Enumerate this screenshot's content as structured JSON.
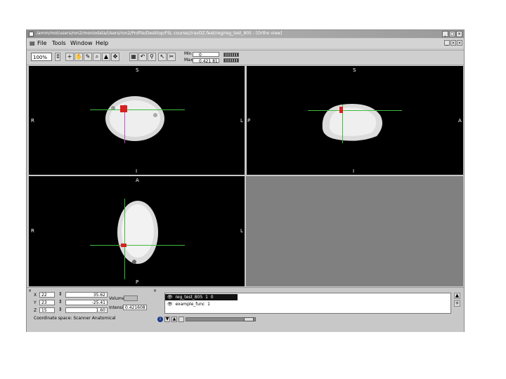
{
  "window": {
    "title": "/amm/mol/users/ron2/mnt/ovdata/Users/ron2/Profile/Desktop/FSL course/fsl/feat/reg/reg_test_805 - [Ortho view]",
    "title_display": "/amm/mol/users/ron2/moniodata/Users/ron2/Profile/Desktop/FSL course///ravDZ.feat/reg/reg_test_805 - [Ortho view]",
    "buttons": [
      "_",
      "□",
      "×"
    ]
  },
  "menu": {
    "items": [
      "File",
      "Tools",
      "Window",
      "Help"
    ],
    "mdi_buttons": [
      "_",
      "×",
      "×"
    ]
  },
  "toolbar": {
    "zoom": "100%",
    "min_label": "Min",
    "min_value": "0",
    "max_label": "Max",
    "max_value": "0.421 81"
  },
  "views": {
    "coronal": {
      "top": "S",
      "bottom": "I",
      "left": "R",
      "right": "L"
    },
    "sagittal": {
      "top": "S",
      "bottom": "I",
      "left": "P",
      "right": "A"
    },
    "axial": {
      "top": "A",
      "bottom": "P",
      "left": "R",
      "right": "L"
    }
  },
  "coords": {
    "x_label": "X",
    "x_voxel": "22",
    "x_mm": "35.62",
    "y_label": "Y",
    "y_voxel": "23",
    "y_mm": "-25.41",
    "z_label": "Z",
    "z_voxel": "15",
    "z_mm": "1.60",
    "volume_label": "Volume",
    "intensity_label": "Intensity",
    "intensity_value": "0.421608",
    "coordinate_space": "Coordinate space: Scanner Anatomical"
  },
  "layers": [
    {
      "name": "reg_test_805",
      "value": "1",
      "extra": "0"
    },
    {
      "name": "example_func",
      "value": "1",
      "extra": ""
    }
  ]
}
